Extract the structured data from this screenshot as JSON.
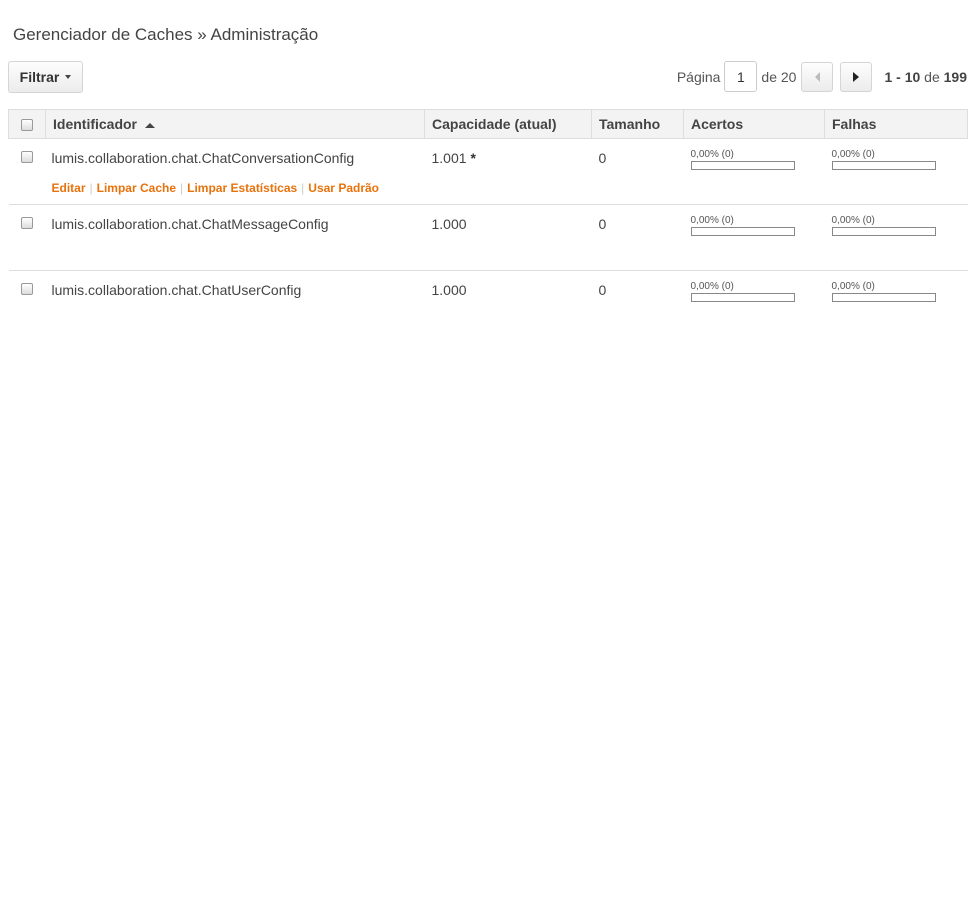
{
  "header": {
    "title": "Gerenciador de Caches » Administração"
  },
  "toolbar": {
    "filter_label": "Filtrar"
  },
  "pager": {
    "page_label": "Página",
    "current_page": "1",
    "of_label": "de 20",
    "range_start_end": "1 - 10",
    "range_of": "de",
    "total": "199"
  },
  "table": {
    "columns": [
      "Identificador",
      "Capacidade (atual)",
      "Tamanho",
      "Acertos",
      "Falhas"
    ],
    "rows": [
      {
        "identifier": "lumis.collaboration.chat.ChatConversationConfig",
        "capacity": "1.001",
        "capacity_mark": "*",
        "size": "0",
        "hits_label": "0,00% (0)",
        "hits_fraction": 0,
        "misses_label": "0,00% (0)",
        "misses_fraction": 0,
        "actions": [
          "Editar",
          "Limpar Cache",
          "Limpar Estatísticas",
          "Usar Padrão"
        ]
      },
      {
        "identifier": "lumis.collaboration.chat.ChatMessageConfig",
        "capacity": "1.000",
        "capacity_mark": "",
        "size": "0",
        "hits_label": "0,00% (0)",
        "hits_fraction": 0,
        "misses_label": "0,00% (0)",
        "misses_fraction": 0
      },
      {
        "identifier": "lumis.collaboration.chat.ChatUserConfig",
        "capacity": "1.000",
        "capacity_mark": "",
        "size": "0",
        "hits_label": "0,00% (0)",
        "hits_fraction": 0,
        "misses_label": "0,00% (0)",
        "misses_fraction": 0
      }
    ]
  },
  "colors": {
    "action_link": "#e8720c",
    "header_bg": "#f3f3f3",
    "border": "#dddddd"
  }
}
